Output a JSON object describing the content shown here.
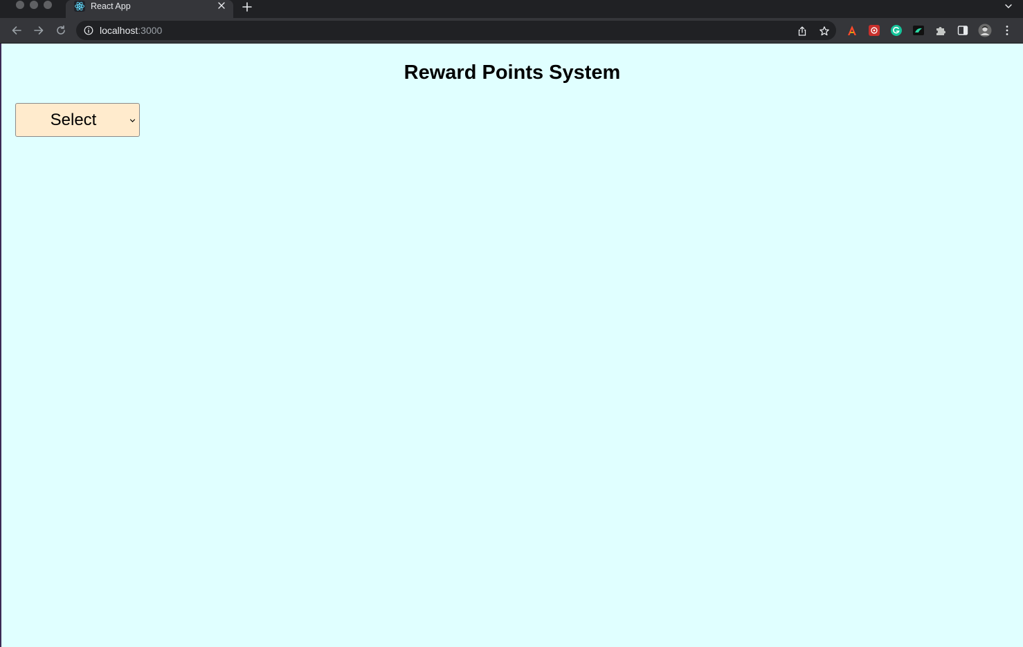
{
  "browser": {
    "tab": {
      "title": "React App"
    },
    "address": {
      "host": "localhost",
      "port": ":3000"
    }
  },
  "page": {
    "title": "Reward Points System",
    "select": {
      "value": "Select"
    }
  },
  "colors": {
    "page_background": "#e0ffff",
    "select_background": "#ffebcd"
  },
  "icons": {
    "tab": [
      "react-logo-icon",
      "close-icon",
      "plus-icon",
      "chevron-down-icon"
    ],
    "toolbar": [
      "back-arrow-icon",
      "forward-arrow-icon",
      "reload-icon",
      "info-icon",
      "share-icon",
      "star-icon"
    ],
    "extensions": [
      "acrobat-icon",
      "extension-icon",
      "grammarly-icon",
      "extension-icon",
      "puzzle-icon",
      "side-panel-icon",
      "profile-avatar-icon",
      "kebab-menu-icon"
    ]
  }
}
